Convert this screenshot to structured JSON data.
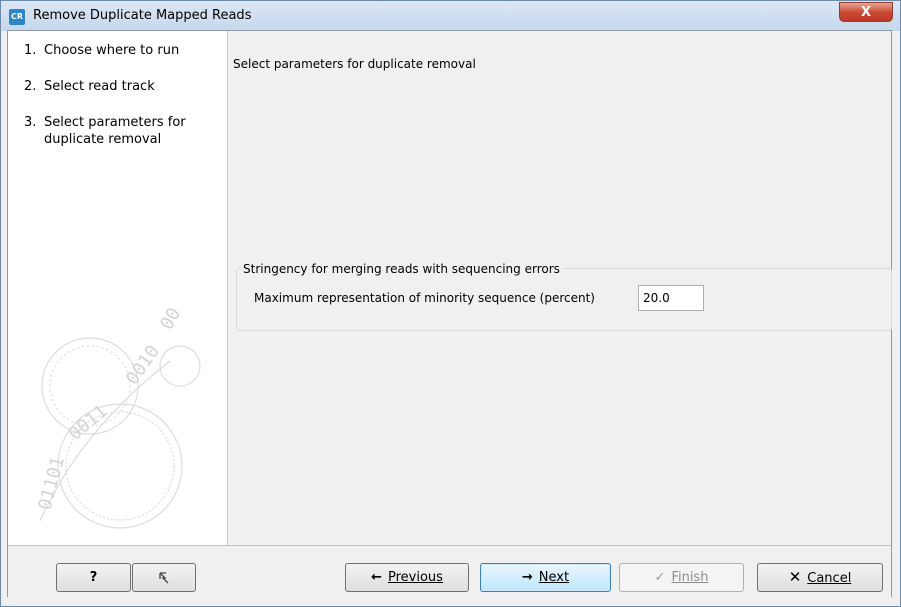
{
  "window": {
    "title": "Remove Duplicate Mapped Reads",
    "app_icon_text": "CR",
    "close_label": "X"
  },
  "sidebar": {
    "steps": [
      {
        "number": "1.",
        "label": "Choose where to run"
      },
      {
        "number": "2.",
        "label": "Select read track"
      },
      {
        "number": "3.",
        "label": "Select parameters for duplicate removal"
      }
    ]
  },
  "main": {
    "heading": "Select parameters for duplicate removal",
    "group": {
      "title": "Stringency for merging reads with sequencing errors",
      "field_label": "Maximum representation of minority sequence (percent)",
      "field_value": "20.0"
    }
  },
  "footer": {
    "help_label": "?",
    "previous_label": "Previous",
    "next_label": "Next",
    "finish_label": "Finish",
    "cancel_label": "Cancel"
  }
}
